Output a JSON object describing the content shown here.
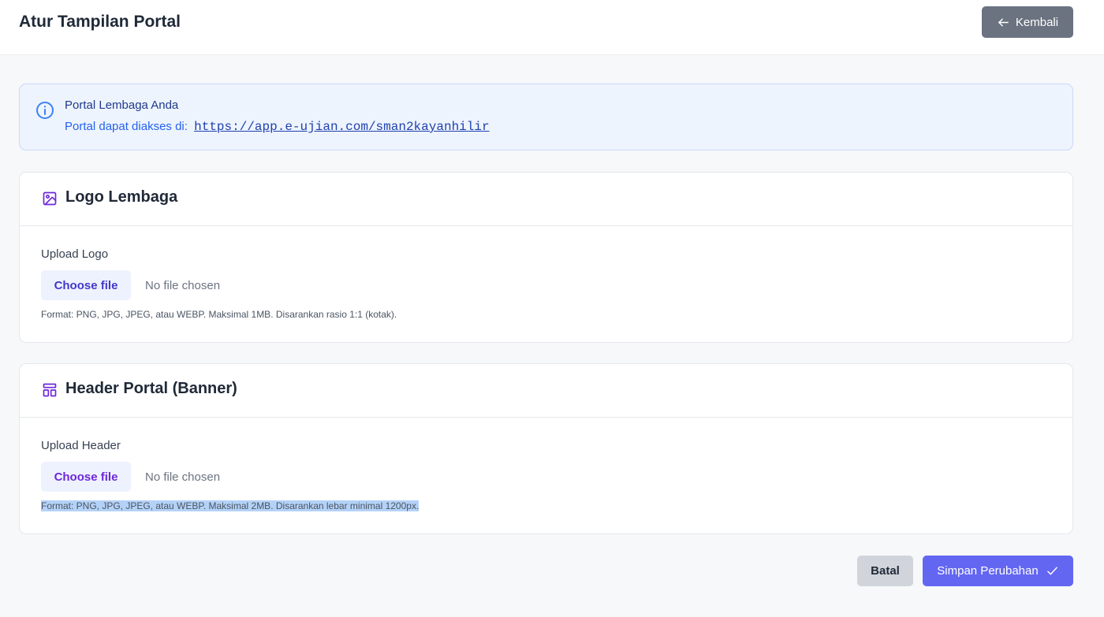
{
  "header": {
    "title": "Atur Tampilan Portal",
    "back_label": "Kembali"
  },
  "info": {
    "title": "Portal Lembaga Anda",
    "prefix": "Portal dapat diakses di:",
    "url": "https://app.e-ujian.com/sman2kayanhilir"
  },
  "logo_card": {
    "title": "Logo Lembaga",
    "label": "Upload Logo",
    "button_label": "Choose file",
    "file_status": "No file chosen",
    "hint": "Format: PNG, JPG, JPEG, atau WEBP. Maksimal 1MB. Disarankan rasio 1:1 (kotak)."
  },
  "header_card": {
    "title": "Header Portal (Banner)",
    "label": "Upload Header",
    "button_label": "Choose file",
    "file_status": "No file chosen",
    "hint": "Format: PNG, JPG, JPEG, atau WEBP. Maksimal 2MB. Disarankan lebar minimal 1200px."
  },
  "actions": {
    "cancel_label": "Batal",
    "save_label": "Simpan Perubahan"
  },
  "icons": {
    "back": "arrow-left-icon",
    "info": "info-circle-icon",
    "logo": "image-icon",
    "header": "layout-icon",
    "save": "check-icon"
  },
  "colors": {
    "primary": "#6366f1",
    "back_button": "#6b7280",
    "info_background": "#eef4fe",
    "link": "#1e40af",
    "card_icon": "#6d28d9"
  }
}
